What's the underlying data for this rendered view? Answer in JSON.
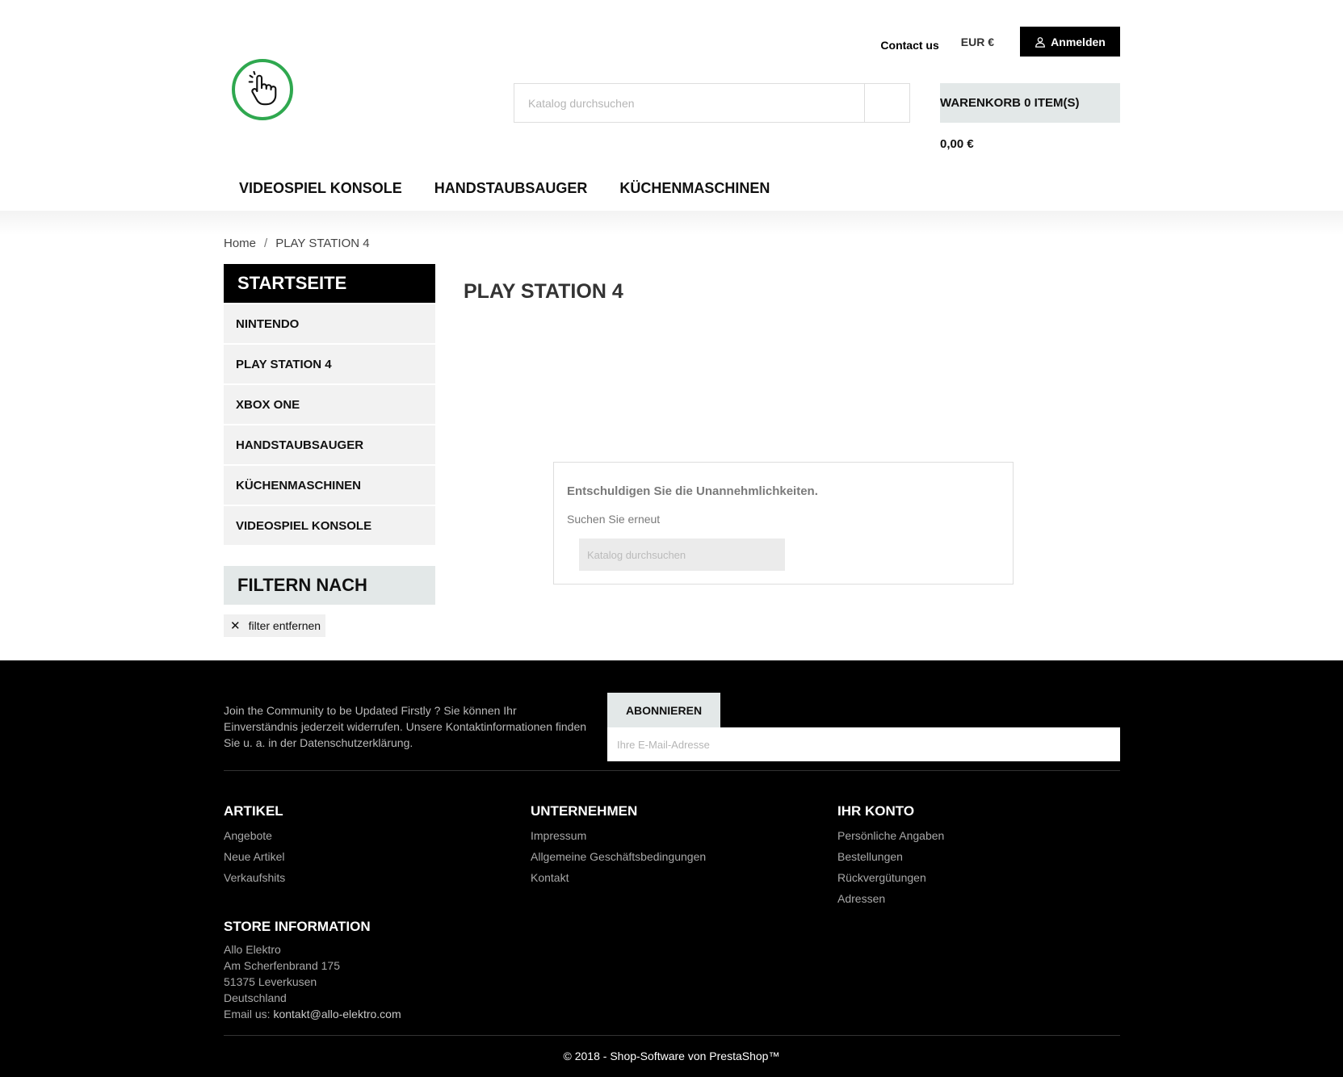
{
  "header": {
    "contact_label": "Contact us",
    "currency_label": "EUR €",
    "signin_label": "Anmelden",
    "search_placeholder": "Katalog durchsuchen",
    "cart_label": "WARENKORB 0 ITEM(S)",
    "cart_total": "0,00 €",
    "nav": [
      "VIDEOSPIEL KONSOLE",
      "HANDSTAUBSAUGER",
      "KÜCHENMASCHINEN"
    ],
    "logo_color": "#2fa84f"
  },
  "breadcrumb": {
    "home": "Home",
    "separator": "/",
    "current": "PLAY STATION 4"
  },
  "sidebar": {
    "title": "STARTSEITE",
    "items": [
      "NINTENDO",
      "PLAY STATION 4",
      "XBOX ONE",
      "HANDSTAUBSAUGER",
      "KÜCHENMASCHINEN",
      "VIDEOSPIEL KONSOLE"
    ],
    "filter_title": "FILTERN NACH",
    "filter_remove_label": "filter entfernen"
  },
  "main": {
    "title": "PLAY STATION 4",
    "not_found": {
      "title": "Entschuldigen Sie die Unannehmlichkeiten.",
      "subtitle": "Suchen Sie erneut",
      "search_placeholder": "Katalog durchsuchen"
    }
  },
  "footer": {
    "newsletter_text": "Join the Community to be Updated Firstly ? Sie können Ihr Einverständnis jederzeit widerrufen. Unsere Kontaktinformationen finden Sie u. a. in der Datenschutzerklärung.",
    "subscribe_label": "ABONNIEREN",
    "email_placeholder": "Ihre E-Mail-Adresse",
    "columns": [
      {
        "title": "ARTIKEL",
        "links": [
          "Angebote",
          "Neue Artikel",
          "Verkaufshits"
        ]
      },
      {
        "title": "UNTERNEHMEN",
        "links": [
          "Impressum",
          "Allgemeine Geschäftsbedingungen",
          "Kontakt"
        ]
      },
      {
        "title": "IHR KONTO",
        "links": [
          "Persönliche Angaben",
          "Bestellungen",
          "Rückvergütungen",
          "Adressen"
        ]
      }
    ],
    "store": {
      "title": "STORE INFORMATION",
      "lines": [
        "Allo Elektro",
        "Am Scherfenbrand 175",
        "51375 Leverkusen",
        "Deutschland"
      ],
      "email_prefix": "Email us: ",
      "email": "kontakt@allo-elektro.com"
    },
    "copyright": "© 2018 - Shop-Software von PrestaShop™"
  }
}
